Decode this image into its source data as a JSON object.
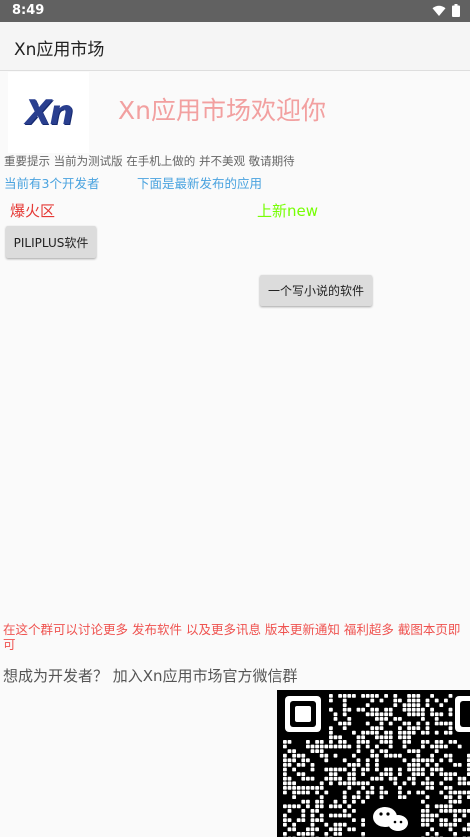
{
  "status": {
    "time": "8:49"
  },
  "appbar": {
    "title": "Xn应用市场"
  },
  "logo": {
    "text": "Xn"
  },
  "welcome": "Xn应用市场欢迎你",
  "notice": "重要提示 当前为测试版 在手机上做的 并不美观 敬请期待",
  "dev_count": "当前有3个开发者",
  "latest_label": "下面是最新发布的应用",
  "hot_section": {
    "title": "爆火区",
    "apps": [
      "PILIPLUS软件"
    ]
  },
  "new_section": {
    "title": "上新new",
    "apps": [
      "一个写小说的软件"
    ]
  },
  "group_info": "在这个群可以讨论更多 发布软件 以及更多讯息 版本更新通知 福利超多 截图本页即可",
  "dev_join": "想成为开发者？ 加入Xn应用市场官方微信群",
  "colors": {
    "welcome": "#f2a0a0",
    "link_blue": "#4aa3df",
    "hot_red": "#e53935",
    "new_green": "#76ff03",
    "group_info_red": "#ef5350"
  },
  "icons": [
    "wifi-icon",
    "battery-icon",
    "wechat-icon",
    "qr-code"
  ]
}
